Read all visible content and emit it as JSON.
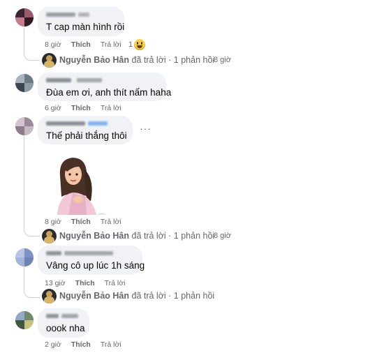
{
  "labels": {
    "like": "Thích",
    "reply": "Trả lời"
  },
  "comments": [
    {
      "text": "T cap màn hình rồi",
      "time": "8 giờ",
      "reaction_count": "1",
      "reaction_icon": "laughing-emoji-icon",
      "reply": {
        "who": "Nguyễn Bảo Hân",
        "action": "đã trả lời · 1 phản hồi",
        "time": "8 giờ"
      }
    },
    {
      "text": "Đùa em ơi, anh thít nấm haha",
      "time": "6 giờ"
    },
    {
      "text": "Thế phải thắng thôi",
      "time": "8 giờ",
      "more": "···",
      "reply": {
        "who": "Nguyễn Bảo Hân",
        "action": "đã trả lời · 1 phản hồi",
        "time": "8 giờ"
      }
    },
    {
      "text": "Vâng cô up lúc 1h sáng",
      "time": "13 giờ",
      "reply": {
        "who": "Nguyễn Bảo Hân",
        "action": "đã trả lời · 1 phản hồi",
        "time": ""
      }
    },
    {
      "text": "oook nha",
      "time": "2 giờ"
    }
  ]
}
